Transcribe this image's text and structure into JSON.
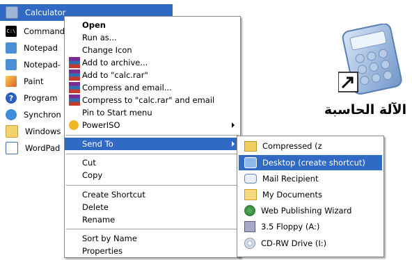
{
  "start_menu": {
    "items": [
      {
        "label": "Calculator",
        "icon": "calculator-icon",
        "selected": true
      },
      {
        "label": "Command",
        "icon": "command-prompt-icon"
      },
      {
        "label": "Notepad",
        "icon": "notepad-icon"
      },
      {
        "label": "Notepad-",
        "icon": "notepad-plus-icon"
      },
      {
        "label": "Paint",
        "icon": "paint-icon"
      },
      {
        "label": "Program",
        "icon": "program-compatibility-icon"
      },
      {
        "label": "Synchron",
        "icon": "synchronize-icon"
      },
      {
        "label": "Windows",
        "icon": "windows-explorer-icon"
      },
      {
        "label": "WordPad",
        "icon": "wordpad-icon"
      }
    ]
  },
  "context_menu": {
    "open": "Open",
    "run_as": "Run as...",
    "change_icon": "Change Icon",
    "add_to_archive": "Add to archive...",
    "add_to_rar": "Add to \"calc.rar\"",
    "compress_email": "Compress and email...",
    "compress_rar_email": "Compress to \"calc.rar\" and email",
    "pin_start": "Pin to Start menu",
    "poweriso": "PowerISO",
    "send_to": "Send To",
    "cut": "Cut",
    "copy": "Copy",
    "create_shortcut": "Create Shortcut",
    "delete": "Delete",
    "rename": "Rename",
    "sort_by_name": "Sort by Name",
    "properties": "Properties"
  },
  "send_to_menu": {
    "compressed": "Compressed (z",
    "desktop": "Desktop (create shortcut)",
    "mail": "Mail Recipient",
    "my_documents": "My Documents",
    "web_publishing": "Web Publishing Wizard",
    "floppy": "3.5 Floppy (A:)",
    "cdrw": "CD-RW Drive (I:)"
  },
  "desktop_icon": {
    "caption": "الآلة الحاسبة",
    "icon": "calculator-shortcut-icon"
  },
  "colors": {
    "selection": "#316ac5",
    "menu_border": "#8a8a8a"
  }
}
